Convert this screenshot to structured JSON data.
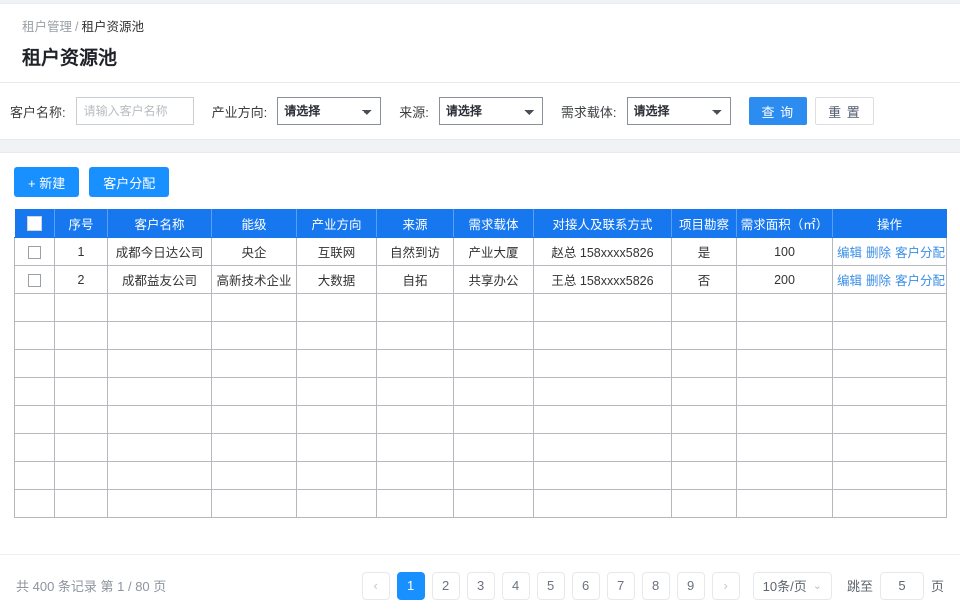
{
  "breadcrumb": {
    "first": "租户管理",
    "separator": "/",
    "last": "租户资源池"
  },
  "page_title": "租户资源池",
  "filters": {
    "customer_name": {
      "label": "客户名称:",
      "placeholder": "请输入客户名称",
      "value": ""
    },
    "industry": {
      "label": "产业方向:",
      "selected": "请选择"
    },
    "source": {
      "label": "来源:",
      "selected": "请选择"
    },
    "carrier": {
      "label": "需求载体:",
      "selected": "请选择"
    },
    "search_button": "查 询",
    "reset_button": "重 置"
  },
  "actions": {
    "create_button": "+ 新建",
    "assign_button": "客户分配"
  },
  "table": {
    "columns": [
      "序号",
      "客户名称",
      "能级",
      "产业方向",
      "来源",
      "需求载体",
      "对接人及联系方式",
      "项目勘察",
      "需求面积（㎡）",
      "操作"
    ],
    "rows": [
      {
        "index": "1",
        "customer": "成都今日达公司",
        "level": "央企",
        "industry": "互联网",
        "source": "自然到访",
        "carrier": "产业大厦",
        "contact": "赵总  158xxxx5826",
        "survey": "是",
        "area": "100",
        "ops": [
          "编辑",
          "删除",
          "客户分配"
        ]
      },
      {
        "index": "2",
        "customer": "成都益友公司",
        "level": "高新技术企业",
        "industry": "大数据",
        "source": "自拓",
        "carrier": "共享办公",
        "contact": "王总  158xxxx5826",
        "survey": "否",
        "area": "200",
        "ops": [
          "编辑",
          "删除",
          "客户分配"
        ]
      }
    ],
    "empty_row_count": 8
  },
  "pagination": {
    "info": "共 400 条记录 第 1 / 80 页",
    "prev": "‹",
    "next": "›",
    "pages": [
      "1",
      "2",
      "3",
      "4",
      "5",
      "6",
      "7",
      "8",
      "9"
    ],
    "active_page": "1",
    "page_size": "10条/页",
    "jump_label": "跳至",
    "jump_value": "5",
    "jump_unit": "页"
  },
  "colors": {
    "primary": "#1890ff",
    "header_blue": "#1677ef",
    "link": "#3a8ee6",
    "band": "#f0f2f5"
  }
}
